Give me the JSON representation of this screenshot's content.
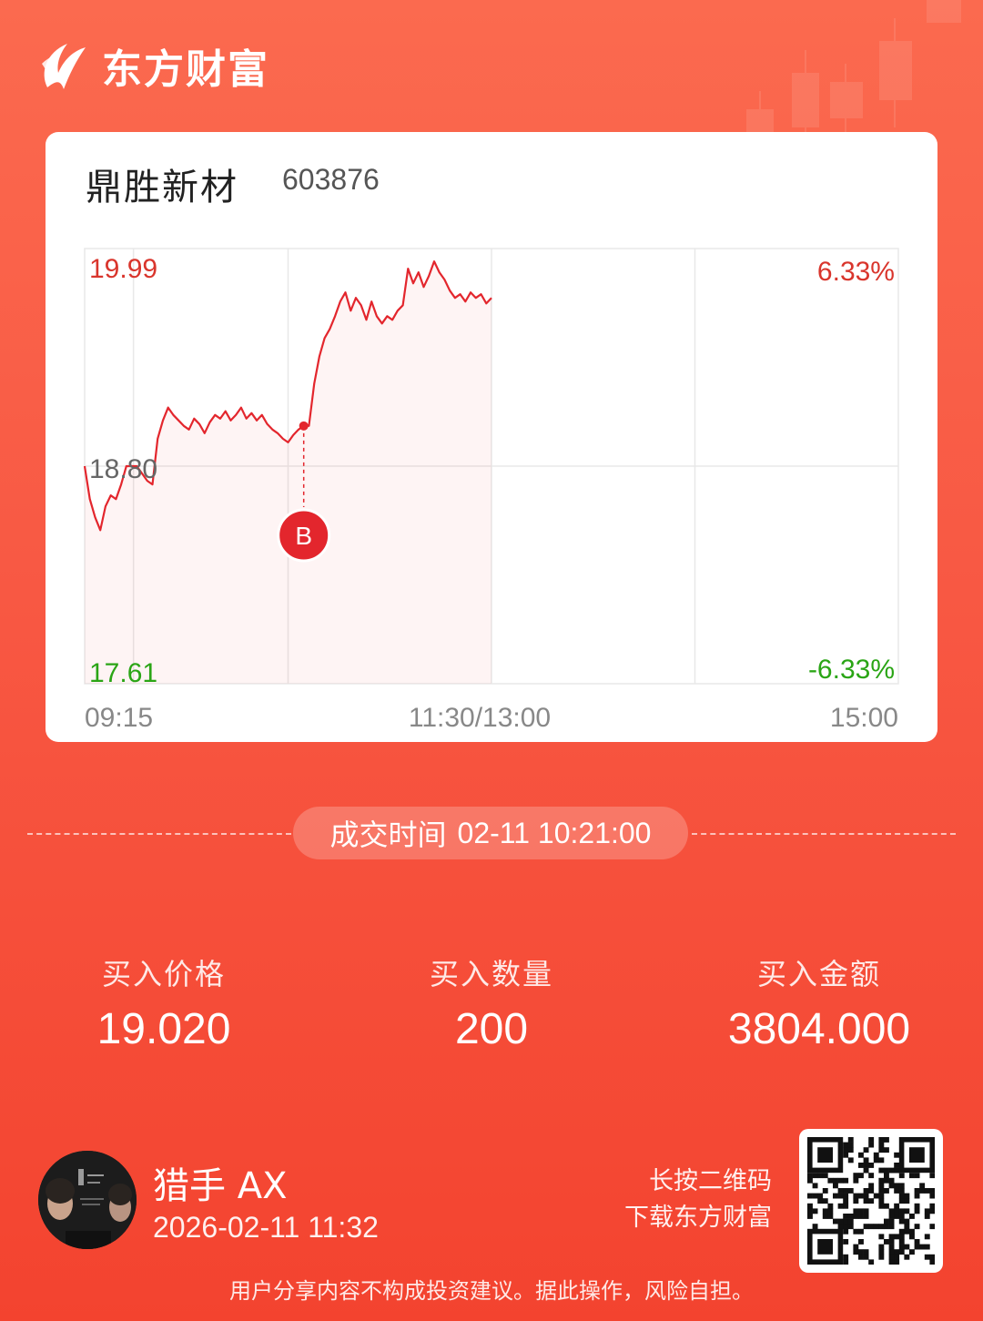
{
  "brand": {
    "name": "东方财富",
    "logo_icon": "eastmoney-logo-icon"
  },
  "stock": {
    "name": "鼎胜新材",
    "code": "603876"
  },
  "chart_data": {
    "type": "line",
    "series": [
      {
        "values": [
          18.8,
          18.62,
          18.52,
          18.45,
          18.58,
          18.64,
          18.62,
          18.7,
          18.8,
          18.8,
          18.8,
          18.76,
          18.72,
          18.7,
          18.95,
          19.05,
          19.12,
          19.08,
          19.05,
          19.02,
          19.0,
          19.06,
          19.03,
          18.98,
          19.04,
          19.08,
          19.06,
          19.1,
          19.05,
          19.08,
          19.12,
          19.06,
          19.09,
          19.05,
          19.08,
          19.03,
          19.0,
          18.98,
          18.95,
          18.93,
          18.97,
          19.0,
          19.02,
          19.02,
          19.25,
          19.4,
          19.5,
          19.55,
          19.62,
          19.7,
          19.75,
          19.65,
          19.72,
          19.68,
          19.6,
          19.7,
          19.62,
          19.58,
          19.62,
          19.6,
          19.65,
          19.68,
          19.88,
          19.8,
          19.86,
          19.78,
          19.84,
          19.92,
          19.86,
          19.82,
          19.76,
          19.72,
          19.74,
          19.7,
          19.75,
          19.72,
          19.74,
          19.69,
          19.72
        ]
      }
    ],
    "x_ticks": [
      "09:15",
      "11:30/13:00",
      "15:00"
    ],
    "y_max_label": "19.99",
    "y_mid_label": "18.80",
    "y_min_label": "17.61",
    "pct_max_label": "6.33%",
    "pct_min_label": "-6.33%",
    "ylim": [
      17.61,
      19.99
    ],
    "buy_marker": {
      "label": "B",
      "time": "10:21",
      "price": 19.02
    },
    "colors": {
      "line": "#e3262d",
      "up_text": "#d9352c",
      "down_text": "#2aa515",
      "grid": "#e8e8e8"
    }
  },
  "deal": {
    "label": "成交时间",
    "time": "02-11 10:21:00"
  },
  "stats": [
    {
      "label": "买入价格",
      "value": "19.020"
    },
    {
      "label": "买入数量",
      "value": "200"
    },
    {
      "label": "买入金额",
      "value": "3804.000"
    }
  ],
  "user": {
    "name": "猎手 AX",
    "share_time": "2026-02-11 11:32",
    "avatar_icon": "user-avatar"
  },
  "qr": {
    "line1": "长按二维码",
    "line2": "下载东方财富",
    "icon": "qr-code-icon"
  },
  "disclaimer": "用户分享内容不构成投资建议。据此操作，风险自担。"
}
